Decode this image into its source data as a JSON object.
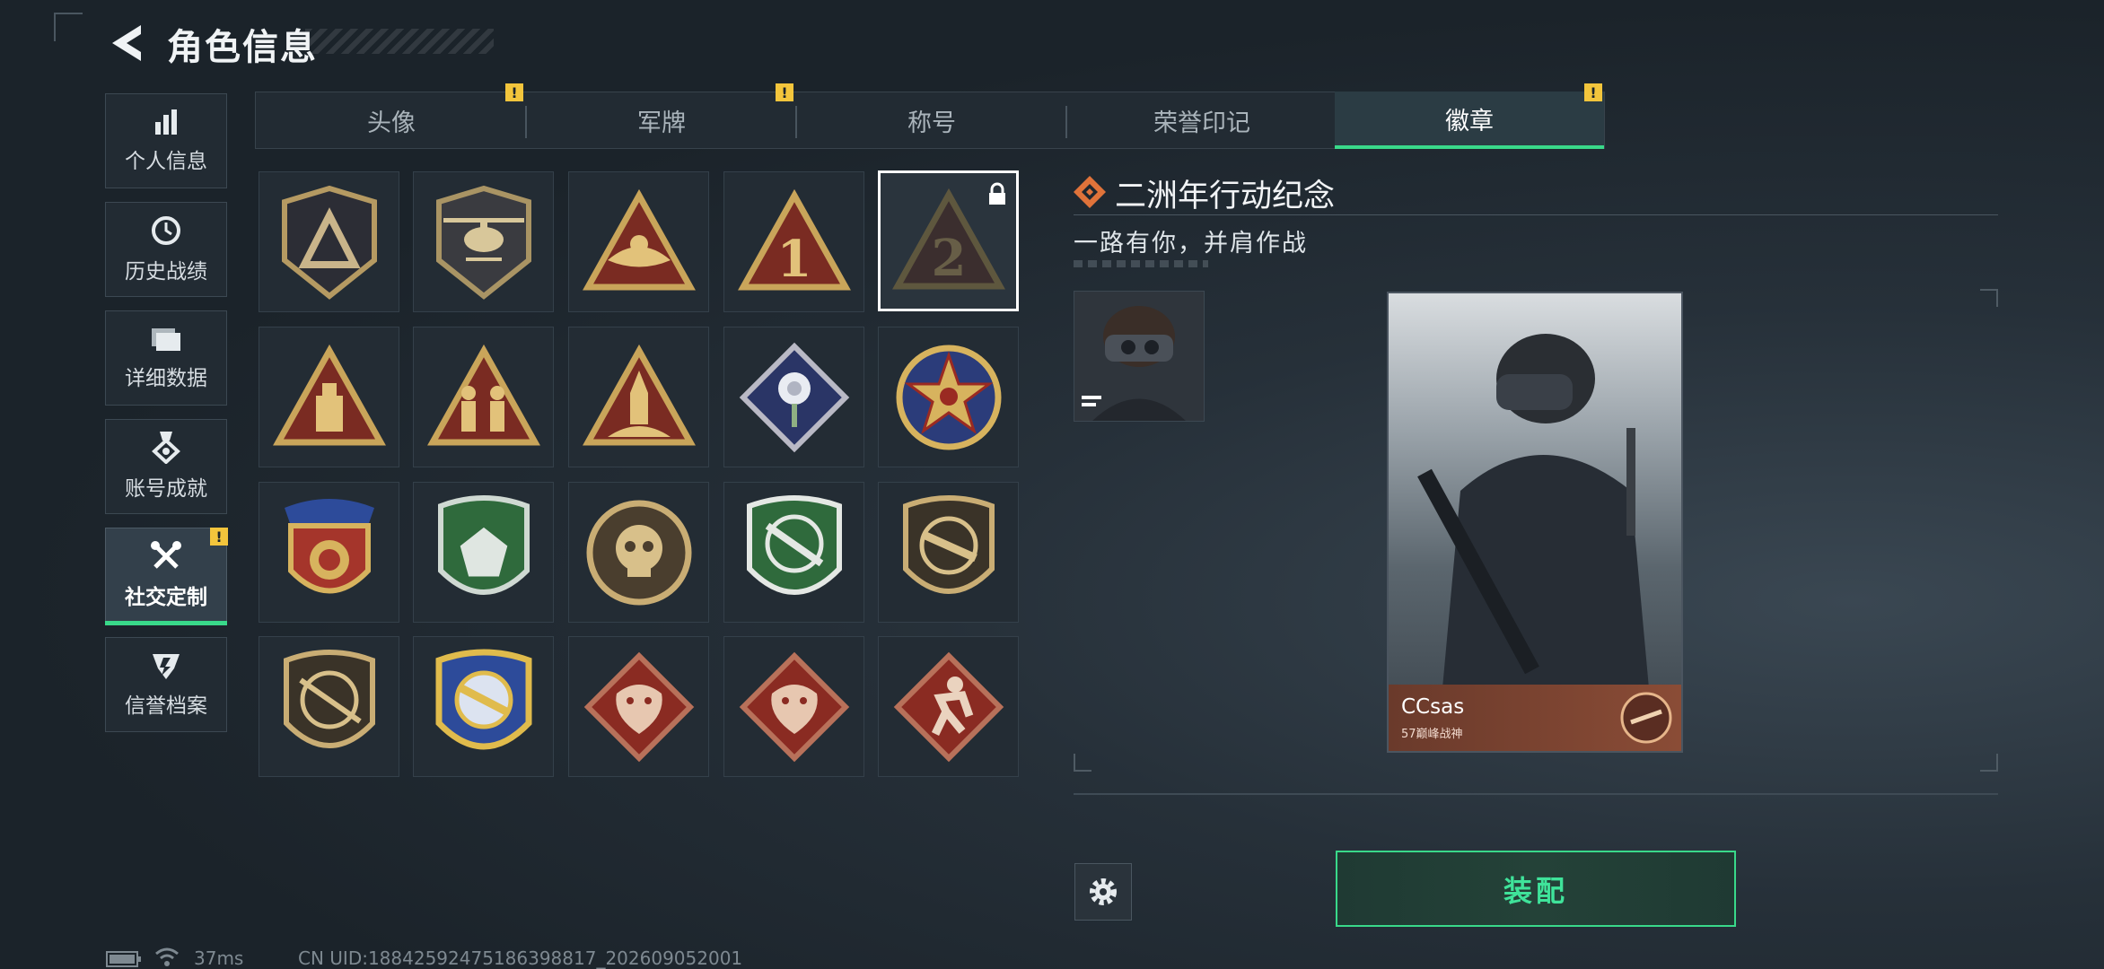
{
  "header": {
    "title": "角色信息",
    "back_icon": "back-arrow-icon"
  },
  "sidebar": {
    "items": [
      {
        "label": "个人信息",
        "icon": "bar-chart-icon",
        "active": false,
        "warn": false
      },
      {
        "label": "历史战绩",
        "icon": "history-clock-icon",
        "active": false,
        "warn": false
      },
      {
        "label": "详细数据",
        "icon": "folder-icon",
        "active": false,
        "warn": false
      },
      {
        "label": "账号成就",
        "icon": "achievement-medal-icon",
        "active": false,
        "warn": false
      },
      {
        "label": "社交定制",
        "icon": "tools-icon",
        "active": true,
        "warn": true
      },
      {
        "label": "信誉档案",
        "icon": "reputation-shield-icon",
        "active": false,
        "warn": false
      }
    ],
    "warn_symbol": "!"
  },
  "tabs": [
    {
      "label": "头像",
      "warn": true,
      "active": false
    },
    {
      "label": "军牌",
      "warn": true,
      "active": false
    },
    {
      "label": "称号",
      "warn": false,
      "active": false
    },
    {
      "label": "荣誉印记",
      "warn": false,
      "active": false
    },
    {
      "label": "徽章",
      "warn": true,
      "active": true
    }
  ],
  "badges": [
    {
      "name": "badge-delta-shield",
      "selected": false,
      "locked": false
    },
    {
      "name": "badge-helicopter",
      "selected": false,
      "locked": false
    },
    {
      "name": "badge-wings-triangle",
      "selected": false,
      "locked": false
    },
    {
      "name": "badge-number-1",
      "selected": false,
      "locked": false
    },
    {
      "name": "badge-number-2",
      "selected": true,
      "locked": true
    },
    {
      "name": "badge-usb-triangle",
      "selected": false,
      "locked": false
    },
    {
      "name": "badge-soldiers-triangle",
      "selected": false,
      "locked": false
    },
    {
      "name": "badge-rocket-triangle",
      "selected": false,
      "locked": false
    },
    {
      "name": "badge-rose-diamond",
      "selected": false,
      "locked": false
    },
    {
      "name": "badge-star-circle",
      "selected": false,
      "locked": false
    },
    {
      "name": "badge-blue-star-shield",
      "selected": false,
      "locked": false
    },
    {
      "name": "badge-green-gem-shield",
      "selected": false,
      "locked": false
    },
    {
      "name": "badge-skull-circle",
      "selected": false,
      "locked": false
    },
    {
      "name": "badge-green-rifle-shield",
      "selected": false,
      "locked": false
    },
    {
      "name": "badge-smg-shield",
      "selected": false,
      "locked": false
    },
    {
      "name": "badge-sniper-shield",
      "selected": false,
      "locked": false
    },
    {
      "name": "badge-crosshair-gold-shield",
      "selected": false,
      "locked": false
    },
    {
      "name": "badge-dragon-diamond-1",
      "selected": false,
      "locked": false
    },
    {
      "name": "badge-dragon-diamond-2",
      "selected": false,
      "locked": false
    },
    {
      "name": "badge-runner-diamond",
      "selected": false,
      "locked": false
    }
  ],
  "detail": {
    "title": "二洲年行动纪念",
    "subtitle": "一路有你，并肩作战"
  },
  "card": {
    "player_name": "CCsas",
    "rank_text": "57巅峰战神"
  },
  "actions": {
    "equip_label": "装配",
    "settings_icon": "gear-icon"
  },
  "status_bar": {
    "ping": "37ms",
    "uid": "CN UID:18842592475186398817_202609052001"
  },
  "colors": {
    "accent_green": "#39d98a",
    "warning_yellow": "#f3c53c",
    "detail_icon_orange": "#e0733a"
  }
}
